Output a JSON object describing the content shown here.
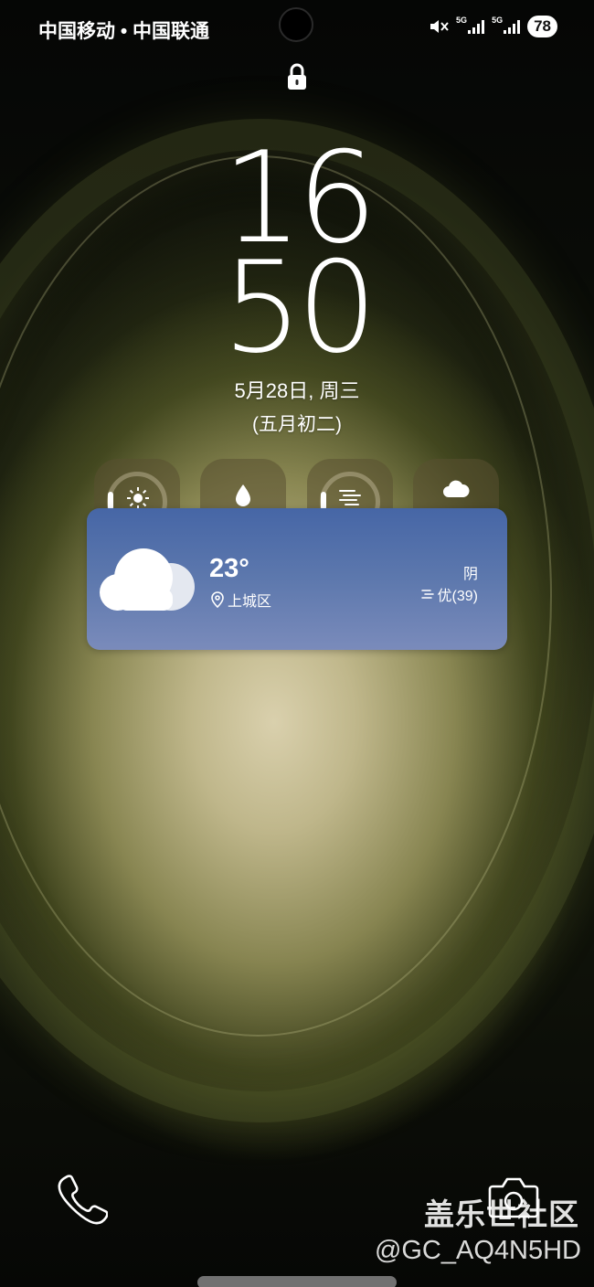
{
  "status_bar": {
    "carrier": "中国移动 • 中国联通",
    "network_1": "5G",
    "network_2": "5G",
    "battery": "78",
    "icons": [
      "mute-icon",
      "signal-icon",
      "signal-icon"
    ]
  },
  "lock": {
    "icon": "lock-icon"
  },
  "clock": {
    "hours": "16",
    "minutes": "50",
    "date": "5月28日, 周三",
    "lunar_date": "(五月初二)"
  },
  "widget_tiles": [
    {
      "icon": "sun-icon"
    },
    {
      "icon": "drop-icon"
    },
    {
      "icon": "wind-icon"
    },
    {
      "icon": "cloud-icon"
    }
  ],
  "weather": {
    "temperature": "23°",
    "location": "上城区",
    "condition": "阴",
    "air_quality": "优(39)",
    "icon": "cloud-icon",
    "colors": {
      "card_top": "#4666a6",
      "card_bottom": "#7a8bbb"
    }
  },
  "shortcuts": {
    "left": "phone-icon",
    "right": "camera-icon"
  },
  "watermark": {
    "title": "盖乐世社区",
    "user": "@GC_AQ4N5HD"
  }
}
